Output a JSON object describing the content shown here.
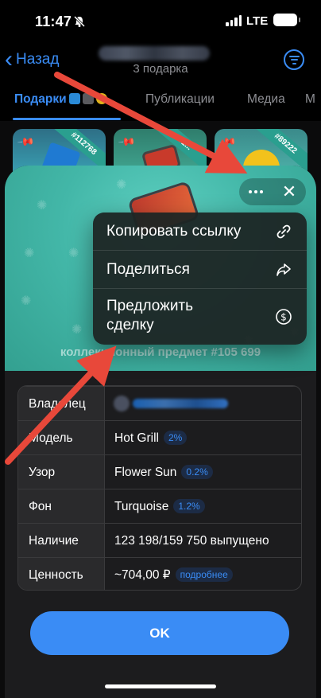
{
  "status_bar": {
    "time": "11:47",
    "network": "LTE",
    "bell_icon": "bell-off-icon"
  },
  "header": {
    "back_label": "Назад",
    "gift_count": "3 подарка",
    "filter_icon": "filter-icon"
  },
  "tabs": [
    {
      "label": "Подарки",
      "active": true
    },
    {
      "label": "Публикации",
      "active": false
    },
    {
      "label": "Медиа",
      "active": false
    },
    {
      "label": "М",
      "active": false
    }
  ],
  "gift_cards": [
    {
      "ribbon": "#112768"
    },
    {
      "ribbon": "#1..."
    },
    {
      "ribbon": "#89222"
    }
  ],
  "sheet": {
    "collectible_label": "коллекционный предмет #105 699"
  },
  "menu": {
    "items": [
      {
        "label": "Копировать ссылку",
        "icon": "link-icon"
      },
      {
        "label": "Поделиться",
        "icon": "share-icon"
      },
      {
        "label": "Предложить\nсделку",
        "icon": "dollar-circle-icon"
      }
    ]
  },
  "info": {
    "rows": [
      {
        "key": "Владелец",
        "value": "",
        "badge": ""
      },
      {
        "key": "Модель",
        "value": "Hot Grill",
        "badge": "2%"
      },
      {
        "key": "Узор",
        "value": "Flower Sun",
        "badge": "0.2%"
      },
      {
        "key": "Фон",
        "value": "Turquoise",
        "badge": "1.2%"
      },
      {
        "key": "Наличие",
        "value": "123 198/159 750 выпущено",
        "badge": ""
      },
      {
        "key": "Ценность",
        "value": "~704,00 ₽",
        "badge": "подробнее"
      }
    ]
  },
  "ok_label": "OK",
  "colors": {
    "accent": "#3a8cf5",
    "hero": "#43b7a8",
    "arrow": "#e8483a"
  }
}
